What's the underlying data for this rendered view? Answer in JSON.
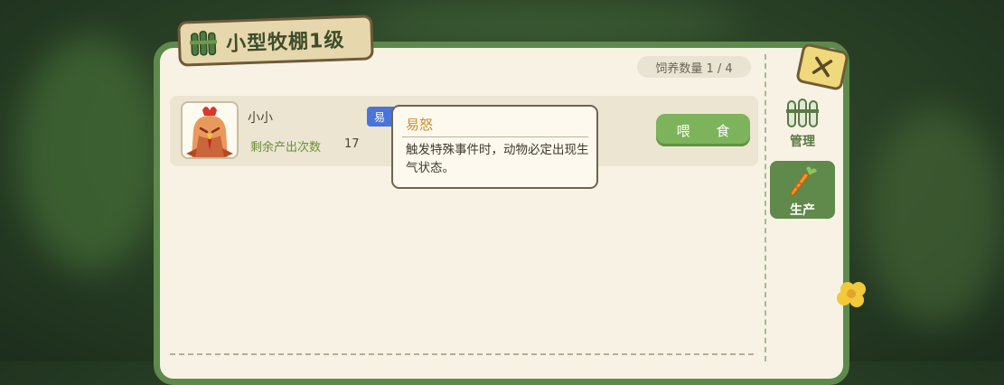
{
  "panel": {
    "title": "小型牧棚1级",
    "feed_count": "饲养数量 1 / 4"
  },
  "animal": {
    "name": "小小",
    "remaining_label": "剩余产出次数",
    "remaining_value": "17",
    "trait_badge": "易",
    "feed_button": "喂 食"
  },
  "tooltip": {
    "title": "易怒",
    "body": "触发特殊事件时，动物必定出现生气状态。"
  },
  "tabs": {
    "manage_label": "管理",
    "produce_label": "生产"
  },
  "colors": {
    "panel_border": "#5d8a4c",
    "panel_bg": "#f7f2e3",
    "feed_button": "#7db35a",
    "trait_badge": "#4a74d8",
    "tooltip_title": "#c7902e"
  },
  "icons": {
    "title": "fence-icon",
    "close": "close-icon",
    "manage": "fence-icon",
    "produce": "carrot-icon",
    "avatar": "chicken-icon"
  }
}
